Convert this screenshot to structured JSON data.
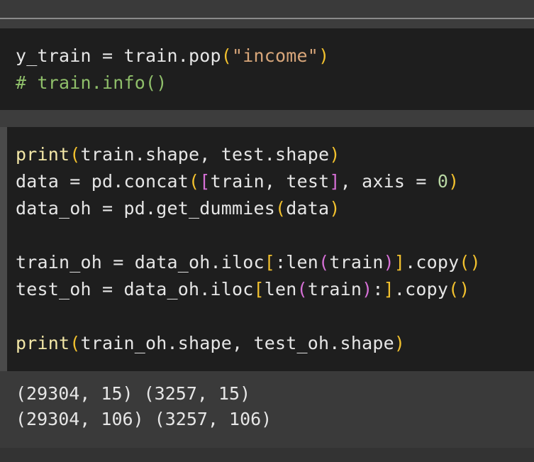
{
  "cell1": {
    "line1": {
      "a": "y_train = train.pop",
      "p_open": "(",
      "str": "\"income\"",
      "p_close": ")"
    },
    "line2": {
      "comment": "# train.info()"
    }
  },
  "cell2": {
    "line1": {
      "fn": "print",
      "p_open": "(",
      "body": "train.shape, test.shape",
      "p_close": ")"
    },
    "line2": {
      "a": "data = pd.concat",
      "p_open": "(",
      "b_open": "[",
      "body": "train, test",
      "b_close": "]",
      "c": ", axis = ",
      "num": "0",
      "p_close": ")"
    },
    "line3": {
      "a": "data_oh = pd.get_dummies",
      "p_open": "(",
      "body": "data",
      "p_close": ")"
    },
    "line4": {
      "a": "train_oh = data_oh.iloc",
      "b_open": "[",
      "b": ":len",
      "p_open": "(",
      "body": "train",
      "p_close": ")",
      "b_close": "]",
      "c": ".copy",
      "p2_open": "(",
      "p2_close": ")"
    },
    "line5": {
      "a": "test_oh = data_oh.iloc",
      "b_open": "[",
      "b": "len",
      "p_open": "(",
      "body": "train",
      "p_close": ")",
      "c": ":",
      "b_close": "]",
      "d": ".copy",
      "p2_open": "(",
      "p2_close": ")"
    },
    "line6": {
      "fn": "print",
      "p_open": "(",
      "body": "train_oh.shape, test_oh.shape",
      "p_close": ")"
    }
  },
  "output": {
    "line1": "(29304, 15) (3257, 15)",
    "line2": "(29304, 106) (3257, 106)"
  },
  "colors": {
    "cell_background": "#1e1e1e",
    "page_background": "#3a3a3a",
    "paren_yellow": "#f2c12e",
    "paren_magenta": "#d670d6",
    "string": "#d8a67a",
    "comment": "#8fbf6a",
    "function": "#f2e6a6"
  }
}
